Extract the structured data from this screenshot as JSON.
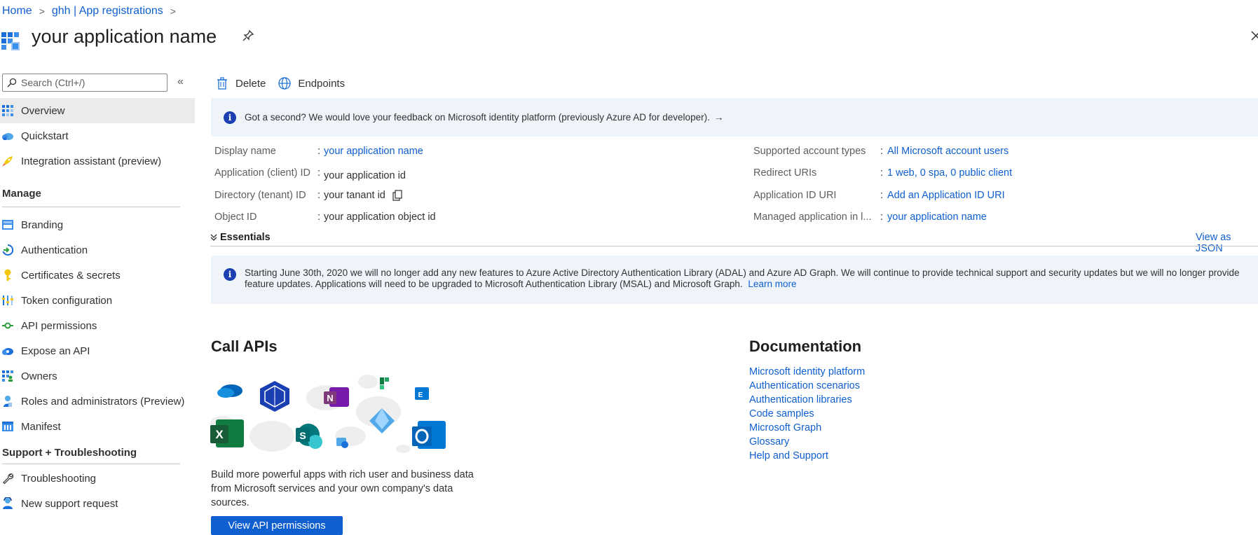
{
  "breadcrumb": {
    "items": [
      "Home",
      "ghh | App registrations"
    ]
  },
  "page": {
    "title": "your application name"
  },
  "sidebar": {
    "search_placeholder": "Search (Ctrl+/)",
    "top_items": [
      {
        "label": "Overview",
        "icon": "grid-icon"
      },
      {
        "label": "Quickstart",
        "icon": "cloud-icon"
      },
      {
        "label": "Integration assistant (preview)",
        "icon": "rocket-icon"
      }
    ],
    "manage_heading": "Manage",
    "manage_items": [
      {
        "label": "Branding",
        "icon": "branding-icon"
      },
      {
        "label": "Authentication",
        "icon": "authentication-icon"
      },
      {
        "label": "Certificates & secrets",
        "icon": "key-icon"
      },
      {
        "label": "Token configuration",
        "icon": "token-icon"
      },
      {
        "label": "API permissions",
        "icon": "api-permissions-icon"
      },
      {
        "label": "Expose an API",
        "icon": "cloud-api-icon"
      },
      {
        "label": "Owners",
        "icon": "owners-icon"
      },
      {
        "label": "Roles and administrators (Preview)",
        "icon": "roles-icon"
      },
      {
        "label": "Manifest",
        "icon": "manifest-icon"
      }
    ],
    "support_heading": "Support + Troubleshooting",
    "support_items": [
      {
        "label": "Troubleshooting",
        "icon": "wrench-icon"
      },
      {
        "label": "New support request",
        "icon": "support-person-icon"
      }
    ]
  },
  "toolbar": {
    "delete_label": "Delete",
    "endpoints_label": "Endpoints"
  },
  "feedback_banner": {
    "text": "Got a second? We would love your feedback on Microsoft identity platform (previously Azure AD for developer).",
    "arrow": "→"
  },
  "essentials": {
    "left": [
      {
        "label": "Display name",
        "value": "your application name",
        "link": true
      },
      {
        "label": "Application (client) ID",
        "value": "your application id",
        "link": false
      },
      {
        "label": "Directory (tenant) ID",
        "value": "your tanant id",
        "link": false
      },
      {
        "label": "Object ID",
        "value": "your application object id",
        "link": false
      }
    ],
    "right": [
      {
        "label": "Supported account types",
        "value": "All Microsoft account users",
        "link": true
      },
      {
        "label": "Redirect URIs",
        "value": "1 web, 0 spa, 0 public client",
        "link": true
      },
      {
        "label": "Application ID URI",
        "value": "Add an Application ID URI",
        "link": true
      },
      {
        "label": "Managed application in l...",
        "value": "your application name",
        "link": true
      }
    ],
    "toggle_label": "Essentials",
    "view_json_label": "View as JSON"
  },
  "adal_banner": {
    "text": "Starting June 30th, 2020 we will no longer add any new features to Azure Active Directory Authentication Library (ADAL) and Azure AD Graph. We will continue to provide technical support and security updates but we will no longer provide feature updates. Applications will need to be upgraded to Microsoft Authentication Library (MSAL) and Microsoft Graph.",
    "link_label": "Learn more"
  },
  "call_apis": {
    "title": "Call APIs",
    "description": "Build more powerful apps with rich user and business data from Microsoft services and your own company's data sources.",
    "button_label": "View API permissions"
  },
  "documentation": {
    "title": "Documentation",
    "links": [
      "Microsoft identity platform",
      "Authentication scenarios",
      "Authentication libraries",
      "Code samples",
      "Microsoft Graph",
      "Glossary",
      "Help and Support"
    ]
  },
  "colors": {
    "link": "#0f5fd0",
    "banner_bg": "#eff4fb",
    "active_nav": "#edebe9",
    "primary": "#0f5fd0"
  }
}
